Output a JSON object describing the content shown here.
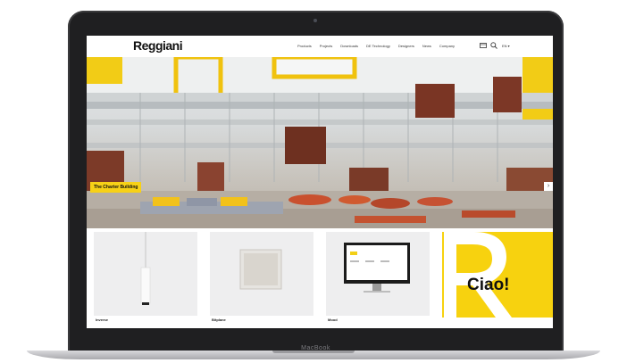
{
  "device": {
    "brand_label": "MacBook"
  },
  "site": {
    "logo": "Reggiani",
    "nav": [
      "Products",
      "Projects",
      "Downloads",
      "DE Technology",
      "Designers",
      "News",
      "Company"
    ],
    "language": "EN ▾",
    "icons": [
      "cart-icon",
      "search-icon"
    ]
  },
  "hero": {
    "caption": "The Charter Building",
    "next_arrow": "›"
  },
  "products": [
    {
      "label": "Inverse"
    },
    {
      "label": "Bitplane"
    },
    {
      "label": "Mood"
    }
  ],
  "promo": {
    "text": "Ciao!",
    "color": "#f7d20f"
  }
}
